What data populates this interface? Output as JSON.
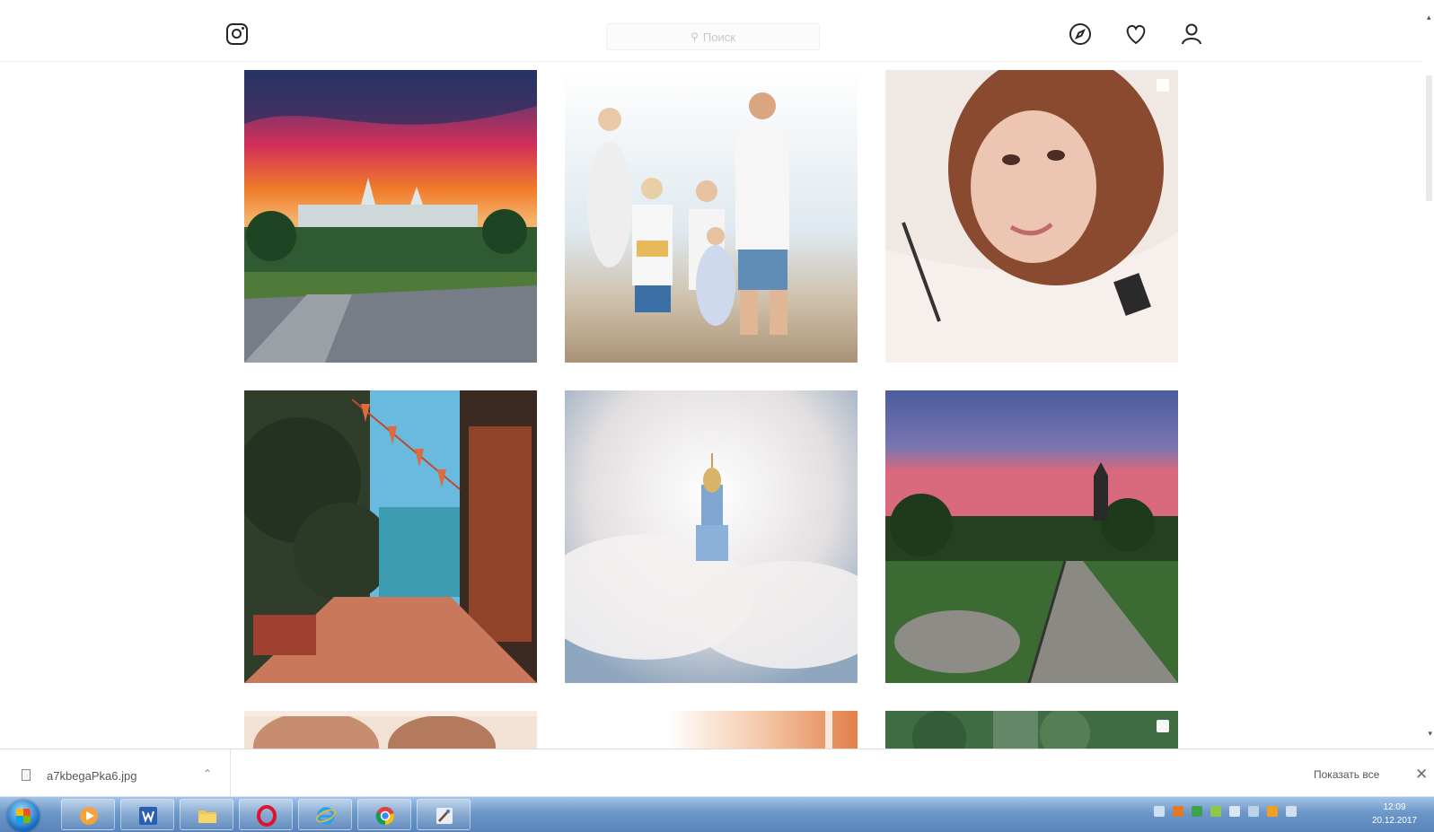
{
  "header": {
    "search": {
      "placeholder": "Поиск",
      "icon": "search-icon"
    },
    "nav_icons": [
      "explore-compass-icon",
      "heart-icon",
      "profile-icon"
    ]
  },
  "grid": {
    "rows": [
      [
        {
          "subject": "sunset-kremlin",
          "colors": [
            "#2b3a7a",
            "#e0335e",
            "#f07a2a",
            "#3e6b3a",
            "#7a7f86"
          ]
        },
        {
          "subject": "family-beach",
          "colors": [
            "#f4f0ea",
            "#dbe7ee",
            "#c9b9a2"
          ]
        },
        {
          "subject": "selfie-girl",
          "colors": [
            "#f1ebe6",
            "#8b4a2e",
            "#e9c2ae"
          ],
          "multi": true
        }
      ],
      [
        {
          "subject": "street-flags",
          "colors": [
            "#6bbbe0",
            "#2e3c2c",
            "#c9785a",
            "#3a2a24"
          ]
        },
        {
          "subject": "church-in-clouds",
          "colors": [
            "#8ea6be",
            "#f1efee",
            "#d7d1d0"
          ]
        },
        {
          "subject": "evening-boardwalk",
          "colors": [
            "#4b5c9a",
            "#cf6b7c",
            "#3f6d38",
            "#7a7c78"
          ]
        }
      ],
      [
        {
          "subject": "faces-closeup",
          "colors": [
            "#c48a6e",
            "#f2e0d4"
          ]
        },
        {
          "subject": "peach-blur",
          "colors": [
            "#ffffff",
            "#f4c6a4",
            "#e88a56"
          ]
        },
        {
          "subject": "green-forest",
          "colors": [
            "#3f6c40",
            "#7d9a82"
          ],
          "multi": true
        }
      ]
    ]
  },
  "download_bar": {
    "file_name": "a7kbegaPka6.jpg",
    "show_all": "Показать все",
    "close_symbol": "✕"
  },
  "taskbar": {
    "apps": [
      "windows-media-player-icon",
      "word-icon",
      "explorer-folder-icon",
      "opera-icon",
      "internet-explorer-icon",
      "chrome-icon",
      "paint-icon"
    ],
    "clock_time": "12:09",
    "clock_date": "20.12.2017"
  }
}
